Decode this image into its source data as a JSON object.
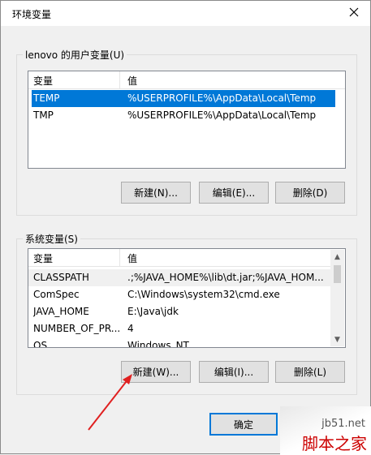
{
  "window": {
    "title": "环境变量",
    "close_glyph": "✕"
  },
  "user_group": {
    "label": "lenovo 的用户变量(U)",
    "columns": [
      "变量",
      "值"
    ],
    "rows": [
      {
        "name": "TEMP",
        "value": "%USERPROFILE%\\AppData\\Local\\Temp",
        "selected": true
      },
      {
        "name": "TMP",
        "value": "%USERPROFILE%\\AppData\\Local\\Temp",
        "selected": false
      }
    ],
    "buttons": {
      "new": "新建(N)...",
      "edit": "编辑(E)...",
      "delete": "删除(D)"
    }
  },
  "system_group": {
    "label": "系统变量(S)",
    "columns": [
      "变量",
      "值"
    ],
    "rows": [
      {
        "name": "CLASSPATH",
        "value": ".;%JAVA_HOME%\\lib\\dt.jar;%JAVA_HOM..."
      },
      {
        "name": "ComSpec",
        "value": "C:\\Windows\\system32\\cmd.exe"
      },
      {
        "name": "JAVA_HOME",
        "value": "E:\\Java\\jdk"
      },
      {
        "name": "NUMBER_OF_PR...",
        "value": "4"
      },
      {
        "name": "OS",
        "value": "Windows_NT"
      }
    ],
    "buttons": {
      "new": "新建(W)...",
      "edit": "编辑(I)...",
      "delete": "删除(L)"
    }
  },
  "footer": {
    "ok": "确定"
  },
  "watermark": {
    "site": "jb51.net",
    "brand": "脚本之家"
  },
  "colors": {
    "selection": "#0078d7",
    "annotation_arrow": "#e02020"
  }
}
